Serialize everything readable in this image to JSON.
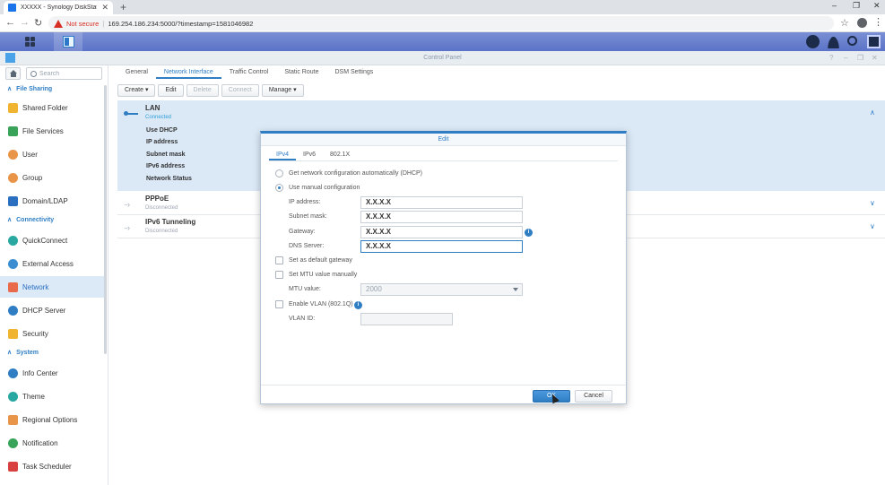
{
  "browser": {
    "tab_title": "XXXXX - Synology DiskStation",
    "tab_close": "✕",
    "new_tab": "+",
    "not_secure": "Not secure",
    "url": "169.254.186.234:5000/?timestamp=1581046982",
    "window_controls": [
      "–",
      "❐",
      "✕"
    ]
  },
  "window": {
    "title": "Control Panel",
    "controls": [
      "?",
      "–",
      "❐",
      "✕"
    ]
  },
  "sidebar": {
    "search_placeholder": "Search",
    "sections": [
      {
        "label": "File Sharing"
      },
      {
        "label": "Connectivity"
      },
      {
        "label": "System"
      }
    ],
    "items": [
      {
        "label": "Shared Folder",
        "color": "#f0b430"
      },
      {
        "label": "File Services",
        "color": "#3aa35a"
      },
      {
        "label": "User",
        "color": "#e8954a"
      },
      {
        "label": "Group",
        "color": "#e8954a"
      },
      {
        "label": "Domain/LDAP",
        "color": "#2a6fc0"
      },
      {
        "label": "QuickConnect",
        "color": "#28a8a0"
      },
      {
        "label": "External Access",
        "color": "#3c8ed0"
      },
      {
        "label": "Network",
        "color": "#e86a4a"
      },
      {
        "label": "DHCP Server",
        "color": "#2f7ec4"
      },
      {
        "label": "Security",
        "color": "#f0b430"
      },
      {
        "label": "Info Center",
        "color": "#2f7ec4"
      },
      {
        "label": "Theme",
        "color": "#28a8a0"
      },
      {
        "label": "Regional Options",
        "color": "#e8954a"
      },
      {
        "label": "Notification",
        "color": "#3aa35a"
      },
      {
        "label": "Task Scheduler",
        "color": "#d94040"
      }
    ]
  },
  "main": {
    "tabs": [
      "General",
      "Network Interface",
      "Traffic Control",
      "Static Route",
      "DSM Settings"
    ],
    "toolbar": {
      "create": "Create ▾",
      "edit": "Edit",
      "delete": "Delete",
      "connect": "Connect",
      "manage": "Manage ▾"
    },
    "interfaces": [
      {
        "name": "LAN",
        "status": "Connected"
      },
      {
        "name": "PPPoE",
        "status": "Disconnected"
      },
      {
        "name": "IPv6 Tunneling",
        "status": "Disconnected"
      }
    ],
    "lan_details": [
      "Use DHCP",
      "IP address",
      "Subnet mask",
      "IPv6 address",
      "Network Status"
    ]
  },
  "modal": {
    "title": "Edit",
    "tabs": [
      "IPv4",
      "IPv6",
      "802.1X"
    ],
    "auto_option": "Get network configuration automatically (DHCP)",
    "manual_option": "Use manual configuration",
    "ip_label": "IP address:",
    "ip_value": "X.X.X.X",
    "subnet_label": "Subnet mask:",
    "subnet_value": "X.X.X.X",
    "gateway_label": "Gateway:",
    "gateway_value": "X.X.X.X",
    "dns_label": "DNS Server:",
    "dns_value": "X.X.X.X",
    "default_gateway": "Set as default gateway",
    "mtu_manual": "Set MTU value manually",
    "mtu_label": "MTU value:",
    "mtu_value": "2000",
    "vlan": "Enable VLAN (802.1Q)",
    "vlan_id_label": "VLAN ID:",
    "info_glyph": "i",
    "ok": "OK",
    "cancel": "Cancel"
  }
}
